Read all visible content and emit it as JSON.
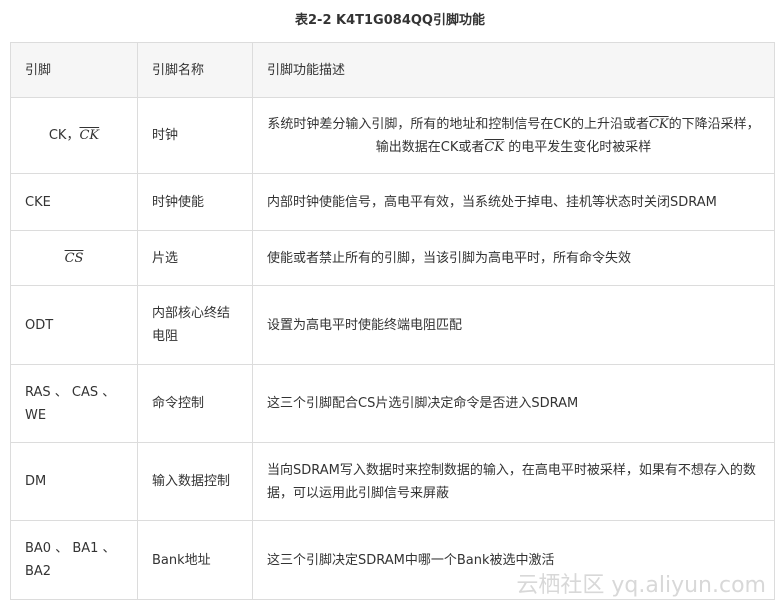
{
  "caption": "表2-2   K4T1G084QQ引脚功能",
  "headers": [
    "引脚",
    "引脚名称",
    "引脚功能描述"
  ],
  "rows": [
    {
      "pin_pre": "CK，",
      "pin_bar": "CK",
      "pin_post": "",
      "name": "时钟",
      "desc_parts": [
        "系统时钟差分输入引脚，所有的地址和控制信号在CK的上升沿或者",
        "CK",
        "的下降沿采样，输出数据在CK或者",
        "CK",
        " 的电平发生变化时被采样"
      ]
    },
    {
      "pin": "CKE",
      "name": "时钟使能",
      "desc": "内部时钟使能信号，高电平有效，当系统处于掉电、挂机等状态时关闭SDRAM"
    },
    {
      "pin_bar": "CS",
      "name": "片选",
      "desc": "使能或者禁止所有的引脚，当该引脚为高电平时，所有命令失效"
    },
    {
      "pin": "ODT",
      "name": "内部核心终结电阻",
      "desc": "设置为高电平时使能终端电阻匹配"
    },
    {
      "pin": "RAS 、 CAS 、 WE",
      "name": "命令控制",
      "desc": "这三个引脚配合CS片选引脚决定命令是否进入SDRAM"
    },
    {
      "pin": "DM",
      "name": "输入数据控制",
      "desc": "当向SDRAM写入数据时来控制数据的输入，在高电平时被采样，如果有不想存入的数据，可以运用此引脚信号来屏蔽"
    },
    {
      "pin": "BA0 、 BA1 、 BA2",
      "name": "Bank地址",
      "desc": "这三个引脚决定SDRAM中哪一个Bank被选中激活"
    }
  ],
  "watermark": "云栖社区 yq.aliyun.com"
}
